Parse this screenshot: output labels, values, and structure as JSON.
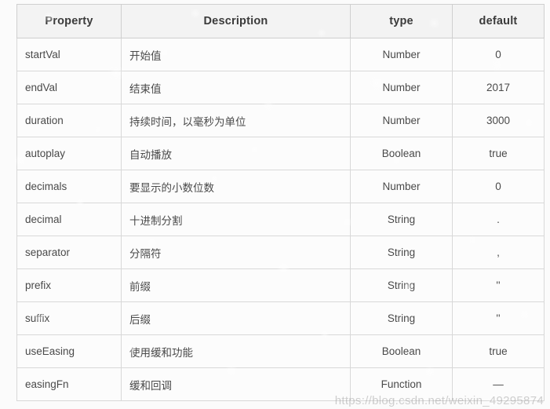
{
  "table": {
    "columns": [
      {
        "key": "property",
        "label": "Property",
        "align": "center"
      },
      {
        "key": "description",
        "label": "Description",
        "align": "center"
      },
      {
        "key": "type",
        "label": "type",
        "align": "center"
      },
      {
        "key": "default",
        "label": "default",
        "align": "center"
      }
    ],
    "rows": [
      {
        "property": "startVal",
        "description": "开始值",
        "type": "Number",
        "default": "0"
      },
      {
        "property": "endVal",
        "description": "结束值",
        "type": "Number",
        "default": "2017"
      },
      {
        "property": "duration",
        "description": "持续时间，以毫秒为单位",
        "type": "Number",
        "default": "3000"
      },
      {
        "property": "autoplay",
        "description": "自动播放",
        "type": "Boolean",
        "default": "true"
      },
      {
        "property": "decimals",
        "description": "要显示的小数位数",
        "type": "Number",
        "default": "0"
      },
      {
        "property": "decimal",
        "description": "十进制分割",
        "type": "String",
        "default": "."
      },
      {
        "property": "separator",
        "description": "分隔符",
        "type": "String",
        "default": ","
      },
      {
        "property": "prefix",
        "description": "前缀",
        "type": "String",
        "default": "''"
      },
      {
        "property": "suffix",
        "description": "后缀",
        "type": "String",
        "default": "''"
      },
      {
        "property": "useEasing",
        "description": "使用缓和功能",
        "type": "Boolean",
        "default": "true"
      },
      {
        "property": "easingFn",
        "description": "缓和回调",
        "type": "Function",
        "default": "—"
      }
    ]
  },
  "watermark": {
    "text": "https://blog.csdn.net/weixin_49295874"
  },
  "colors": {
    "page_background": "#fbfbfb",
    "table_background": "#fcfcfc",
    "header_background": "#f3f3f3",
    "border": "#d8d8d8",
    "header_border": "#cfcfcf",
    "text": "#4a4a4a",
    "header_text": "#3b3b3b",
    "watermark_text": "#969696"
  }
}
